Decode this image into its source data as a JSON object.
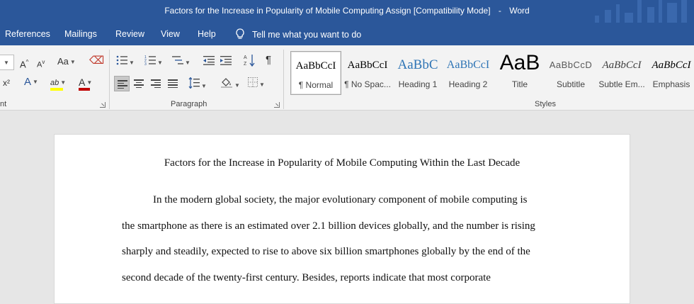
{
  "window": {
    "title": "Factors for the Increase in Popularity of Mobile Computing Assign [Compatibility Mode]",
    "separator": "-",
    "app": "Word"
  },
  "menu": {
    "tabs": [
      "References",
      "Mailings",
      "Review",
      "View",
      "Help"
    ],
    "tell_me": "Tell me what you want to do"
  },
  "ribbon": {
    "groups": {
      "font": "nt",
      "paragraph": "Paragraph",
      "styles": "Styles"
    },
    "font_icons": {
      "grow": "A",
      "shrink": "A",
      "case": "Aa",
      "superscript": "x²",
      "effects": "A",
      "highlight": "ab",
      "font_color": "A"
    },
    "colors": {
      "highlight": "#ffff00",
      "font_color": "#c00000",
      "accent": "#2b579a"
    },
    "styles": [
      {
        "sample": "AaBbCcI",
        "name": "¶ Normal"
      },
      {
        "sample": "AaBbCcI",
        "name": "¶ No Spac..."
      },
      {
        "sample": "AaBbC",
        "name": "Heading 1"
      },
      {
        "sample": "AaBbCcI",
        "name": "Heading 2"
      },
      {
        "sample": "AaB",
        "name": "Title"
      },
      {
        "sample": "AaBbCcD",
        "name": "Subtitle"
      },
      {
        "sample": "AaBbCcI",
        "name": "Subtle Em..."
      },
      {
        "sample": "AaBbCcI",
        "name": "Emphasis"
      }
    ]
  },
  "document": {
    "title": "Factors for the Increase in Popularity of Mobile Computing Within the Last Decade",
    "lines": [
      "In the modern global society, the major evolutionary component of mobile computing is",
      "the smartphone as there is an estimated over 2.1 billion devices globally, and the number is rising",
      "sharply and steadily, expected to rise to above six billion smartphones globally by the end of the",
      "second decade of the twenty-first century. Besides, reports indicate that most corporate"
    ]
  }
}
